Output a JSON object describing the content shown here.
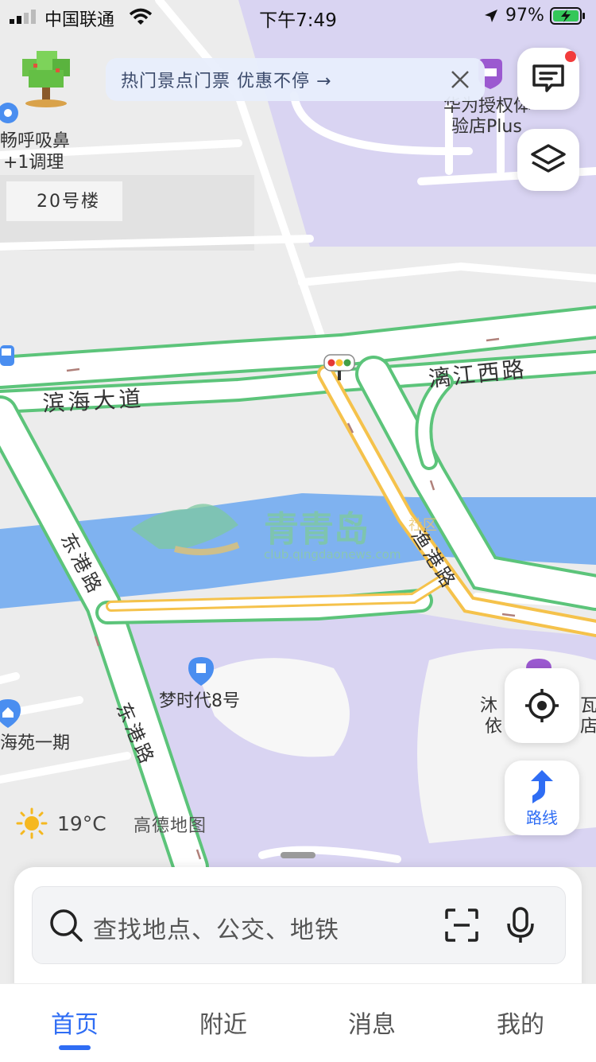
{
  "status_bar": {
    "carrier": "中国联通",
    "time": "下午7:49",
    "battery": "97%"
  },
  "banner": {
    "text": "热门景点门票  优惠不停 →"
  },
  "map": {
    "labels": {
      "building_20": "20号楼",
      "poi_breath_1": "畅呼吸鼻",
      "poi_breath_2": "+1调理",
      "huawei_1": "华为授权体",
      "huawei_2": "验店Plus",
      "binhai": "滨海大道",
      "lijiang": "漓江西路",
      "donggang_1": "东港路",
      "donggang_2": "东港路",
      "yugang": "渔港路",
      "mengshidai": "梦时代8号",
      "haiyuan": "海苑一期",
      "mu_1": "沐",
      "mu_2": "依",
      "mu_3": "瓦",
      "mu_4": "店"
    },
    "watermark": {
      "title": "青青岛",
      "tag": "社区",
      "url": "club.qingdaonews.com"
    }
  },
  "weather": {
    "temp": "19°C",
    "icon": "sun-icon"
  },
  "brand": "高德地图",
  "route_button": {
    "label": "路线"
  },
  "search": {
    "placeholder": "查找地点、公交、地铁"
  },
  "tabs": [
    {
      "label": "首页",
      "active": true
    },
    {
      "label": "附近",
      "active": false
    },
    {
      "label": "消息",
      "active": false
    },
    {
      "label": "我的",
      "active": false
    }
  ],
  "colors": {
    "accent": "#2f6df4",
    "road_edge": "#5cc47a",
    "water": "#7fb2f0",
    "landuse": "#d9d4f2",
    "primary_road": "#f5c24b"
  }
}
